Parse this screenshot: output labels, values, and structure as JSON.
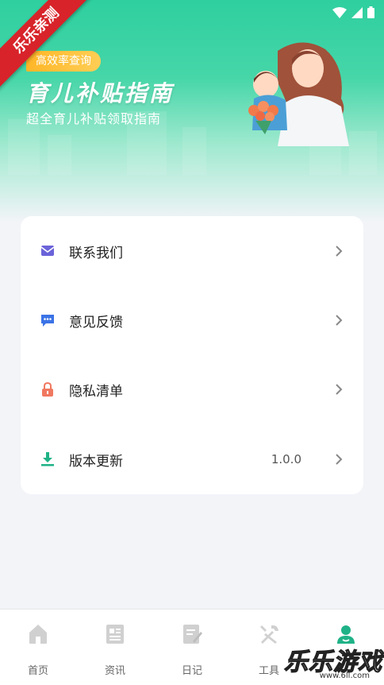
{
  "banner": {
    "badge": "高效率查询",
    "title": "育儿补贴指南",
    "subtitle": "超全育儿补贴领取指南",
    "ribbon": "乐乐亲测"
  },
  "menu": {
    "items": [
      {
        "label": "联系我们",
        "icon": "mail-icon",
        "value": ""
      },
      {
        "label": "意见反馈",
        "icon": "feedback-icon",
        "value": ""
      },
      {
        "label": "隐私清单",
        "icon": "lock-icon",
        "value": ""
      },
      {
        "label": "版本更新",
        "icon": "download-icon",
        "value": "1.0.0"
      }
    ]
  },
  "tabbar": {
    "tabs": [
      {
        "label": "首页",
        "icon": "home-icon"
      },
      {
        "label": "资讯",
        "icon": "news-icon"
      },
      {
        "label": "日记",
        "icon": "diary-icon"
      },
      {
        "label": "工具",
        "icon": "tools-icon"
      },
      {
        "label": "我的",
        "icon": "profile-icon",
        "active": true
      }
    ]
  },
  "watermark": {
    "text": "乐乐游戏",
    "url": "www.6ll.com"
  },
  "colors": {
    "accent": "#1fb287",
    "hero": "#2fcf9f",
    "badge": "#ffb627",
    "ribbon": "#d8232a"
  }
}
